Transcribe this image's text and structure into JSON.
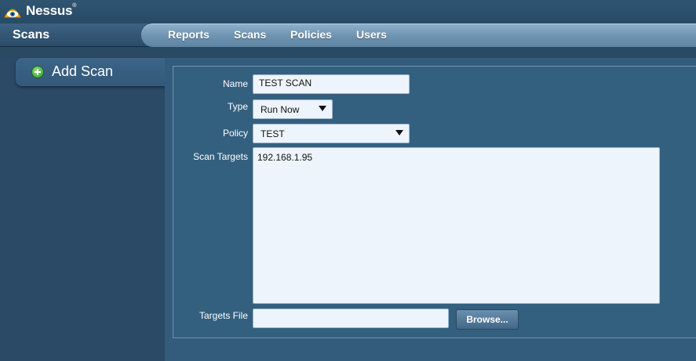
{
  "app": {
    "name": "Nessus",
    "trademark": "®"
  },
  "header": {
    "section_title": "Scans"
  },
  "nav": {
    "items": [
      "Reports",
      "Scans",
      "Policies",
      "Users"
    ]
  },
  "sidebar": {
    "add_scan_label": "Add Scan"
  },
  "form": {
    "name_label": "Name",
    "name_value": "TEST SCAN",
    "type_label": "Type",
    "type_value": "Run Now",
    "policy_label": "Policy",
    "policy_value": "TEST",
    "targets_label": "Scan Targets",
    "targets_value": "192.168.1.95",
    "targets_file_label": "Targets File",
    "targets_file_value": "",
    "browse_label": "Browse..."
  },
  "colors": {
    "background": "#2e4f6a",
    "nav_bar": "#7a9fbc",
    "panel": "#34607f",
    "field_bg": "#eef4fb"
  }
}
